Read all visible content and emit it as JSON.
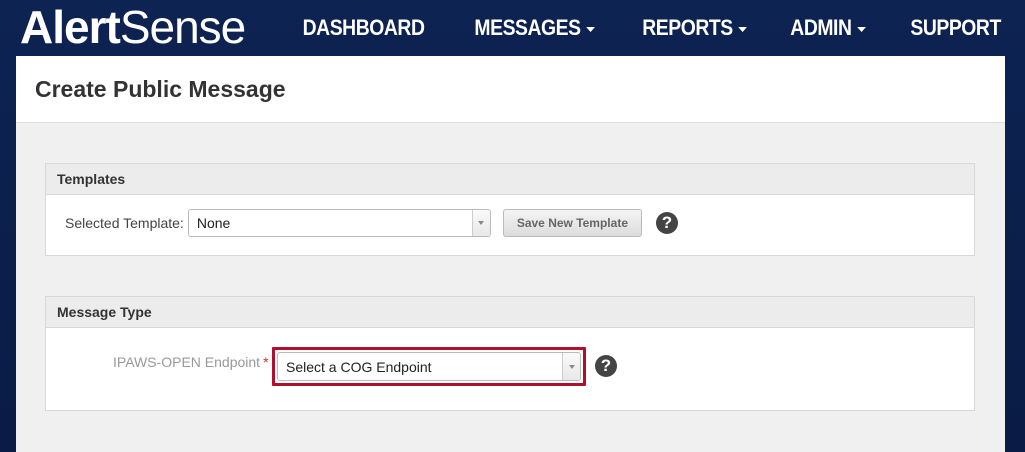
{
  "header": {
    "logo_bold": "Alert",
    "logo_light": "Sense",
    "nav": [
      {
        "label": "DASHBOARD",
        "dropdown": false
      },
      {
        "label": "MESSAGES",
        "dropdown": true
      },
      {
        "label": "REPORTS",
        "dropdown": true
      },
      {
        "label": "ADMIN",
        "dropdown": true
      },
      {
        "label": "SUPPORT",
        "dropdown": false
      }
    ]
  },
  "page": {
    "title": "Create Public Message"
  },
  "templates_panel": {
    "heading": "Templates",
    "label": "Selected Template:",
    "selected_value": "None",
    "save_button": "Save New Template",
    "help_icon": "?"
  },
  "message_type_panel": {
    "heading": "Message Type",
    "label": "IPAWS-OPEN Endpoint",
    "required_marker": "*",
    "selected_value": "Select a COG Endpoint",
    "help_icon": "?"
  },
  "colors": {
    "header_bg": "#0b1e48",
    "highlight": "#b0102b",
    "required": "#d32f2f"
  }
}
